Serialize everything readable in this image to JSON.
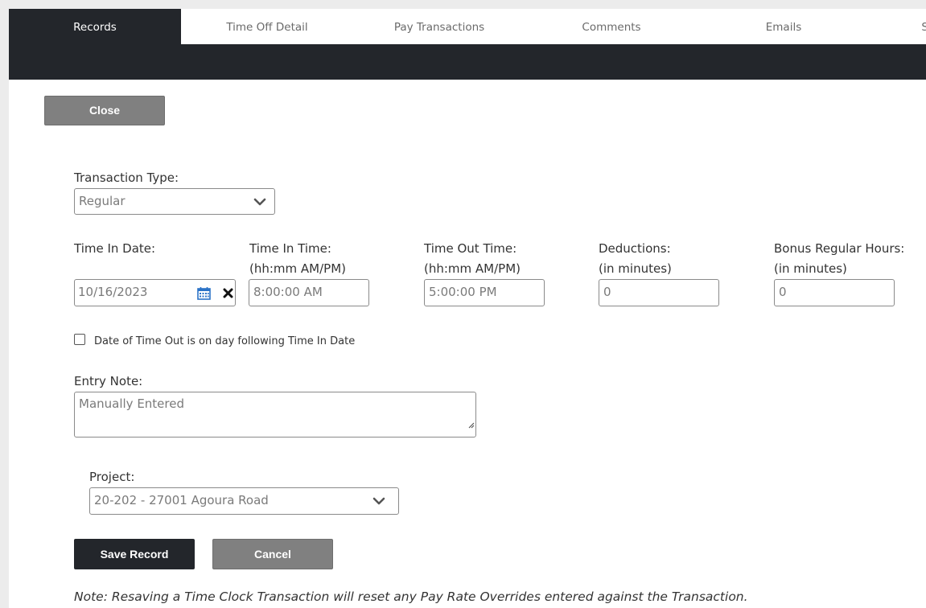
{
  "tabs": [
    {
      "label": "Records",
      "active": true
    },
    {
      "label": "Time Off Detail",
      "active": false
    },
    {
      "label": "Pay Transactions",
      "active": false
    },
    {
      "label": "Comments",
      "active": false
    },
    {
      "label": "Emails",
      "active": false
    },
    {
      "label": "Submit Time",
      "active": false
    }
  ],
  "close_button": "Close",
  "form": {
    "transaction_type": {
      "label": "Transaction Type:",
      "value": "Regular"
    },
    "time_in_date": {
      "label": "Time In Date:",
      "value": "10/16/2023"
    },
    "time_in_time": {
      "label": "Time In Time:",
      "sublabel": "(hh:mm AM/PM)",
      "value": "8:00:00 AM"
    },
    "time_out_time": {
      "label": "Time Out Time:",
      "sublabel": "(hh:mm AM/PM)",
      "value": "5:00:00 PM"
    },
    "deductions": {
      "label": "Deductions:",
      "sublabel": "(in minutes)",
      "value": "0"
    },
    "bonus_regular_hours": {
      "label": "Bonus Regular Hours:",
      "sublabel": "(in minutes)",
      "value": "0"
    },
    "next_day_checkbox": {
      "label": "Date of Time Out is on day following Time In Date",
      "checked": false
    },
    "entry_note": {
      "label": "Entry Note:",
      "value": "Manually Entered"
    },
    "project": {
      "label": "Project:",
      "value": "20-202 - 27001 Agoura Road"
    }
  },
  "buttons": {
    "save": "Save Record",
    "cancel": "Cancel"
  },
  "note": "Note: Resaving a Time Clock Transaction will reset any Pay Rate Overrides entered against the Transaction.",
  "colors": {
    "dark": "#23262b",
    "gray_button": "#808080",
    "calendar_icon": "#2b73c7"
  }
}
